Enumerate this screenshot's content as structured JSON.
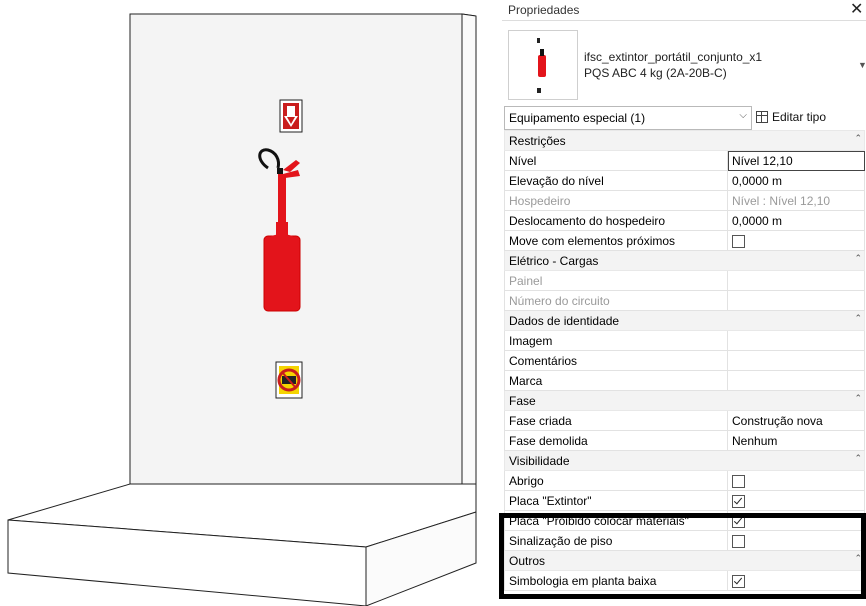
{
  "panel": {
    "title": "Propriedades",
    "close_glyph": "✕",
    "type_name_line1": "ifsc_extintor_portátil_conjunto_x1",
    "type_name_line2": "PQS ABC 4 kg (2A-20B-C)",
    "selector_label": "Equipamento especial (1)",
    "edit_type_label": "Editar tipo"
  },
  "groups": {
    "restricoes": "Restrições",
    "eletrico": "Elétrico - Cargas",
    "identidade": "Dados de identidade",
    "fase": "Fase",
    "visibilidade": "Visibilidade",
    "outros": "Outros"
  },
  "rows": {
    "nivel": {
      "name": "Nível",
      "value": "Nível 12,10"
    },
    "elevacao": {
      "name": "Elevação do nível",
      "value": "0,0000 m"
    },
    "hospedeiro": {
      "name": "Hospedeiro",
      "value": "Nível : Nível 12,10"
    },
    "deslocamento": {
      "name": "Deslocamento do hospedeiro",
      "value": "0,0000 m"
    },
    "move": {
      "name": "Move com elementos próximos",
      "checked": false
    },
    "painel": {
      "name": "Painel",
      "value": ""
    },
    "circuito": {
      "name": "Número do circuito",
      "value": ""
    },
    "imagem": {
      "name": "Imagem",
      "value": ""
    },
    "comentarios": {
      "name": "Comentários",
      "value": ""
    },
    "marca": {
      "name": "Marca",
      "value": ""
    },
    "fase_criada": {
      "name": "Fase criada",
      "value": "Construção nova"
    },
    "fase_demolida": {
      "name": "Fase demolida",
      "value": "Nenhum"
    },
    "abrigo": {
      "name": "Abrigo",
      "checked": false
    },
    "placa_extintor": {
      "name": "Placa \"Extintor\"",
      "checked": true
    },
    "placa_proibido": {
      "name": "Placa \"Proibido colocar materiais\"",
      "checked": true
    },
    "sinalizacao": {
      "name": "Sinalização de piso",
      "checked": false
    },
    "simbologia": {
      "name": "Simbologia em planta baixa",
      "checked": true
    }
  },
  "colors": {
    "extinguisher_red": "#e3141b",
    "highlight_border": "#000000"
  },
  "icons": {
    "collapse": "chevron-up-double-icon",
    "dropdown": "chevron-down-icon",
    "edit_type": "edit-type-icon"
  }
}
